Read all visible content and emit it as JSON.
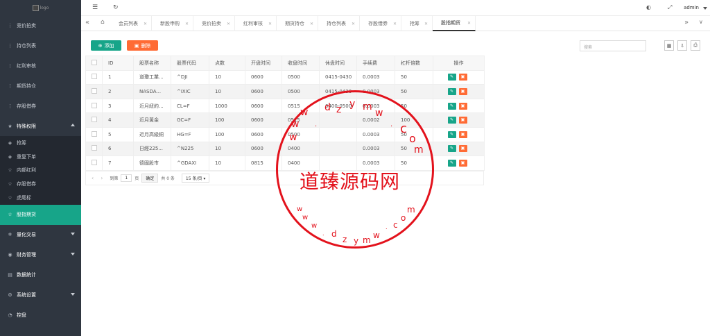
{
  "logo_alt": "logo",
  "sidebar": {
    "items": [
      {
        "icon": "dots-icon",
        "label": "竞价拍卖"
      },
      {
        "icon": "dots-icon",
        "label": "持仓列表"
      },
      {
        "icon": "dots-icon",
        "label": "红利审核"
      },
      {
        "icon": "dots-icon",
        "label": "期货持仓"
      },
      {
        "icon": "dots-icon",
        "label": "存股借券"
      }
    ],
    "group": {
      "icon": "star-icon",
      "label": "特殊权限"
    },
    "sub_items": [
      {
        "icon": "diamond-icon",
        "label": "抢筹"
      },
      {
        "icon": "diamond-icon",
        "label": "重复下单"
      },
      {
        "icon": "star-outline-icon",
        "label": "内部红利"
      },
      {
        "icon": "star-outline-icon",
        "label": "存股借券"
      },
      {
        "icon": "star-outline-icon",
        "label": "虎尾标"
      }
    ],
    "active": {
      "icon": "star-outline-icon",
      "label": "股指期货"
    },
    "bottom_items": [
      {
        "icon": "snowflake-icon",
        "label": "量化交易",
        "caret": true
      },
      {
        "icon": "money-icon",
        "label": "财务管理",
        "caret": true
      },
      {
        "icon": "chart-icon",
        "label": "数据统计",
        "caret": false
      },
      {
        "icon": "gear-icon",
        "label": "系统设置",
        "caret": true
      },
      {
        "icon": "gauge-icon",
        "label": "控盘",
        "caret": false
      }
    ]
  },
  "header": {
    "menu_icon": "☰",
    "refresh_icon": "↻",
    "user": "admin"
  },
  "tabs": [
    "会员列表",
    "新股申购",
    "竞价拍卖",
    "红利审核",
    "期货持仓",
    "持仓列表",
    "存股借券",
    "抢筹",
    "股指期货"
  ],
  "toolbar": {
    "add_label": "添加",
    "delete_label": "删除",
    "search_placeholder": "搜索"
  },
  "table": {
    "headers": [
      "ID",
      "股票名称",
      "股票代码",
      "点数",
      "开盘时间",
      "收盘时间",
      "休盘时间",
      "手续费",
      "杠杆倍数",
      "操作"
    ],
    "rows": [
      [
        "1",
        "道瓊工業...",
        "^DJI",
        "10",
        "0600",
        "0500",
        "0415-0430",
        "0.0003",
        "50"
      ],
      [
        "2",
        "NASDA...",
        "^IXIC",
        "10",
        "0600",
        "0500",
        "0415-0430",
        "0.0003",
        "50"
      ],
      [
        "3",
        "近月紐約...",
        "CL=F",
        "1000",
        "0600",
        "0515",
        "0400-0500",
        "0.0003",
        "50"
      ],
      [
        "4",
        "近月黃金",
        "GC=F",
        "100",
        "0600",
        "0515",
        "",
        "0.0002",
        "100"
      ],
      [
        "5",
        "近月高級銅",
        "HG=F",
        "100",
        "0600",
        "0500",
        "",
        "0.0003",
        "50"
      ],
      [
        "6",
        "日經225...",
        "^N225",
        "10",
        "0600",
        "0400",
        "",
        "0.0003",
        "50"
      ],
      [
        "7",
        "德國股市",
        "^GDAXI",
        "10",
        "0815",
        "0400",
        "",
        "0.0003",
        "50"
      ]
    ]
  },
  "pager": {
    "to_label": "到第",
    "page": "1",
    "page_unit": "页",
    "confirm": "确定",
    "total": "共 0 条",
    "per_page": "15 条/页"
  },
  "watermark": {
    "center": "道臻源码网",
    "top_chars": [
      "w",
      "w",
      "w",
      ".",
      "d",
      "z",
      "y",
      "m",
      "w",
      ".",
      "c",
      "o",
      "m"
    ],
    "bottom_chars": [
      "w",
      "w",
      "w",
      ".",
      "d",
      "z",
      "y",
      "m",
      "w",
      ".",
      "c",
      "o",
      "m"
    ]
  }
}
